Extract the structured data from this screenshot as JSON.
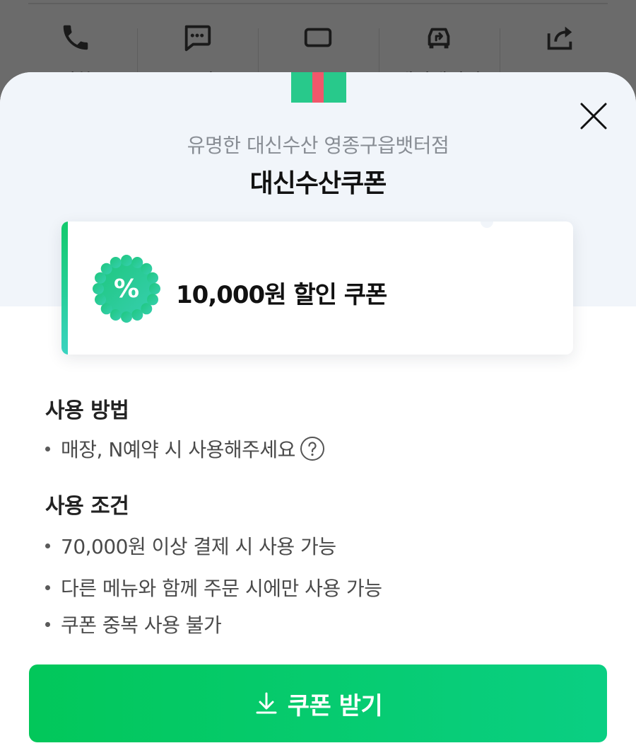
{
  "background_actions": [
    {
      "icon": "phone-icon",
      "label": "전화"
    },
    {
      "icon": "chat-icon",
      "label": "문의"
    },
    {
      "icon": "coupon-icon",
      "label": "쿠폰"
    },
    {
      "icon": "car-navigation-icon",
      "label": "내비게이션"
    },
    {
      "icon": "share-icon",
      "label": "공유"
    }
  ],
  "sheet": {
    "store_name": "유명한 대신수산 영종구읍뱃터점",
    "title": "대신수산쿠폰",
    "coupon": {
      "badge_symbol": "%",
      "amount_label": "10,000원 할인 쿠폰"
    },
    "usage_method": {
      "heading": "사용 방법",
      "items": [
        "매장, N예약 시 사용해주세요"
      ]
    },
    "usage_conditions": {
      "heading": "사용 조건",
      "items": [
        "70,000원 이상 결제 시 사용 가능",
        "다른 메뉴와 함께 주문 시에만 사용 가능",
        "쿠폰 중복 사용 불가"
      ]
    },
    "cta_label": "쿠폰 받기"
  },
  "colors": {
    "accent_green": "#03C75A",
    "teal": "#2fd0a8",
    "overlay": "#6b6b6b",
    "sheet_top_bg": "#f1f5fa"
  }
}
